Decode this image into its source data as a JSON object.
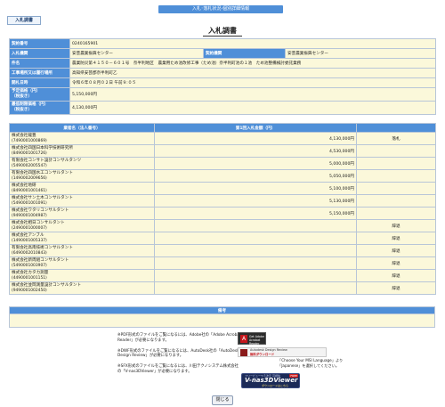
{
  "header": {
    "top_bar": "入札･落札状況-個別詳細情報",
    "tab_button": "入札調書",
    "page_title": "入札調書"
  },
  "info": {
    "contract_no_label": "契約番号",
    "contract_no": "0240165901",
    "bid_org_label": "入札機関",
    "bid_org": "安芸農業振興センター",
    "contract_org_label": "契約機関",
    "contract_org": "安芸農業振興センター",
    "subject_label": "件名",
    "subject": "農業防災第４１５０－６０１号　奈半利地区　農業用ため池改修工事（ため池）奈半利町池の１池　ため池整備検討委託業務",
    "location_label": "工事場所又は履行場所",
    "location": "高知県安芸郡奈半利町乙",
    "open_date_label": "開札日時",
    "open_date": "令和６年０８月０２日 午前９:０５",
    "planned_price_label": "予定価格（円）",
    "planned_price_note": "（税抜き）",
    "planned_price": "5,150,000円",
    "min_price_label": "最低制限価格（円）",
    "min_price_note": "（税抜き）",
    "min_price": "4,130,000円"
  },
  "bids": {
    "col_name": "業者名（法人番号）",
    "col_amount": "第1回入札金額（円）",
    "col_note": "",
    "rows": [
      {
        "name": "株式会社龍豊",
        "id": "(7490001000869)",
        "amount": "4,130,000円",
        "note": "落札"
      },
      {
        "name": "株式会社四国日本科学技術研究所",
        "id": "(8490001001726)",
        "amount": "4,530,000円",
        "note": ""
      },
      {
        "name": "有限会社コンサト設計コンサルタンツ",
        "id": "(5490002005547)",
        "amount": "5,000,000円",
        "note": ""
      },
      {
        "name": "有限会社四国水工コンサルタント",
        "id": "(1490002009656)",
        "amount": "5,050,000円",
        "note": ""
      },
      {
        "name": "株式会社地研",
        "id": "(8490001001461)",
        "amount": "5,100,000円",
        "note": ""
      },
      {
        "name": "株式会社サン土木コンサルタント",
        "id": "(5490001001091)",
        "amount": "5,130,000円",
        "note": ""
      },
      {
        "name": "株式会社ワタリコンサルタント",
        "id": "(9490001004987)",
        "amount": "5,150,000円",
        "note": ""
      },
      {
        "name": "株式会社相日コンサルタント",
        "id": "(2490001000007)",
        "amount": "",
        "note": "辞退"
      },
      {
        "name": "株式会社アンブル",
        "id": "(1490001005337)",
        "amount": "",
        "note": "辞退"
      },
      {
        "name": "有限会社高南技術コンサルタント",
        "id": "(6490002010843)",
        "amount": "",
        "note": "辞退"
      },
      {
        "name": "株式会社新周組コンサルタント",
        "id": "(5490001003907)",
        "amount": "",
        "note": "辞退"
      },
      {
        "name": "株式会社カタカ測量",
        "id": "(4490001001151)",
        "amount": "",
        "note": "辞退"
      },
      {
        "name": "株式会社並岡測量設計コンサルタント",
        "id": "(9490001002450)",
        "amount": "",
        "note": "辞退"
      }
    ]
  },
  "remarks": {
    "label": "備考",
    "value": ""
  },
  "notes": {
    "pdf": "※PDF形式のファイルをご覧になるには、Adobe社の「Adobe Acrobat Reader」が必要になります。",
    "dwf": "※DWF形式のファイルをご覧になるには、AutoDesk社の「AutoDesk Design Review」が必要になります。",
    "sfx": "※SFX形式のファイルをご覧になるには、川田テクノシステム株式会社の「V-nas3DViewer」が必要になります。",
    "msi": "「Choose Your MSI Language」より「Japanese」を選択してください。"
  },
  "badges": {
    "adobe_line1": "Get Adobe",
    "adobe_line2": "Acrobat Reader",
    "dwf_line1": "Autodesk Design Review",
    "dwf_line2": "無料ダウンロード",
    "vnas_line0": "フリービューワ３次元 可視化",
    "vnas_title": "V-nas3DViewer",
    "vnas_free": "FREE",
    "vnas_sub": "ダウンロードはこちら"
  },
  "footer": {
    "close_button": "閉じる"
  },
  "colors": {
    "accent": "#4f8fd8",
    "cell_bg": "#fbf8da"
  }
}
